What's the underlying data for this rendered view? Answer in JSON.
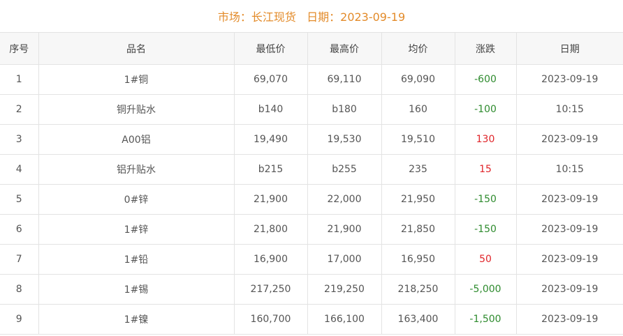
{
  "title": "市场：长江现货   日期：2023-09-19",
  "columns": [
    "序号",
    "品名",
    "最低价",
    "最高价",
    "均价",
    "涨跌",
    "日期"
  ],
  "colors": {
    "title": "#e38b2a",
    "change_down": "#2e8b2e",
    "change_up": "#e0252a",
    "header_bg": "#f7f7f7",
    "border": "#e3e3e3"
  },
  "rows": [
    {
      "index": "1",
      "name": "1#铜",
      "low": "69,070",
      "high": "69,110",
      "avg": "69,090",
      "change": "-600",
      "direction": "down",
      "date": "2023-09-19"
    },
    {
      "index": "2",
      "name": "铜升贴水",
      "low": "b140",
      "high": "b180",
      "avg": "160",
      "change": "-100",
      "direction": "down",
      "date": "10:15"
    },
    {
      "index": "3",
      "name": "A00铝",
      "low": "19,490",
      "high": "19,530",
      "avg": "19,510",
      "change": "130",
      "direction": "up",
      "date": "2023-09-19"
    },
    {
      "index": "4",
      "name": "铝升贴水",
      "low": "b215",
      "high": "b255",
      "avg": "235",
      "change": "15",
      "direction": "up",
      "date": "10:15"
    },
    {
      "index": "5",
      "name": "0#锌",
      "low": "21,900",
      "high": "22,000",
      "avg": "21,950",
      "change": "-150",
      "direction": "down",
      "date": "2023-09-19"
    },
    {
      "index": "6",
      "name": "1#锌",
      "low": "21,800",
      "high": "21,900",
      "avg": "21,850",
      "change": "-150",
      "direction": "down",
      "date": "2023-09-19"
    },
    {
      "index": "7",
      "name": "1#铅",
      "low": "16,900",
      "high": "17,000",
      "avg": "16,950",
      "change": "50",
      "direction": "up",
      "date": "2023-09-19"
    },
    {
      "index": "8",
      "name": "1#锡",
      "low": "217,250",
      "high": "219,250",
      "avg": "218,250",
      "change": "-5,000",
      "direction": "down",
      "date": "2023-09-19"
    },
    {
      "index": "9",
      "name": "1#镍",
      "low": "160,700",
      "high": "166,100",
      "avg": "163,400",
      "change": "-1,500",
      "direction": "down",
      "date": "2023-09-19"
    }
  ]
}
